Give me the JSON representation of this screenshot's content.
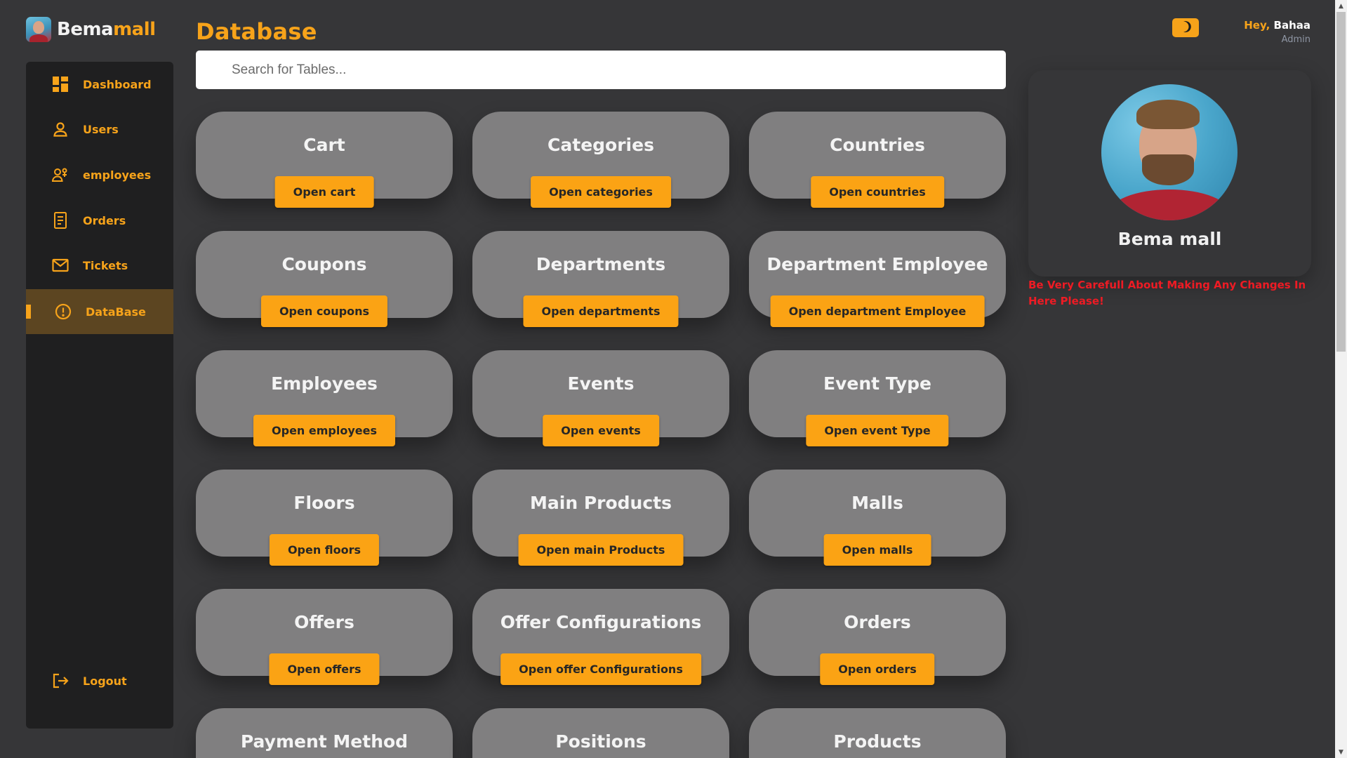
{
  "brand": {
    "part1": "Bema",
    "part2": "mall"
  },
  "sidebar": {
    "items": [
      {
        "label": "Dashboard",
        "icon": "dashboard-icon"
      },
      {
        "label": "Users",
        "icon": "user-icon"
      },
      {
        "label": "employees",
        "icon": "employees-icon"
      },
      {
        "label": "Orders",
        "icon": "receipt-icon"
      },
      {
        "label": "Tickets",
        "icon": "mail-icon"
      },
      {
        "label": "DataBase",
        "icon": "alert-circle-icon",
        "active": true
      }
    ],
    "logout": {
      "label": "Logout",
      "icon": "logout-icon"
    }
  },
  "header": {
    "title": "Database",
    "search_placeholder": "Search for Tables..."
  },
  "user": {
    "greeting": "Hey, ",
    "name": "Bahaa",
    "role": "Admin"
  },
  "profile": {
    "name": "Bema mall",
    "warning": "Be Very Carefull About Making Any Changes In Here Please!"
  },
  "tables": [
    {
      "title": "Cart",
      "button": "Open cart"
    },
    {
      "title": "Categories",
      "button": "Open categories"
    },
    {
      "title": "Countries",
      "button": "Open countries"
    },
    {
      "title": "Coupons",
      "button": "Open coupons"
    },
    {
      "title": "Departments",
      "button": "Open departments"
    },
    {
      "title": "Department Employee",
      "button": "Open department Employee"
    },
    {
      "title": "Employees",
      "button": "Open employees"
    },
    {
      "title": "Events",
      "button": "Open events"
    },
    {
      "title": "Event Type",
      "button": "Open event Type"
    },
    {
      "title": "Floors",
      "button": "Open floors"
    },
    {
      "title": "Main Products",
      "button": "Open main Products"
    },
    {
      "title": "Malls",
      "button": "Open malls"
    },
    {
      "title": "Offers",
      "button": "Open offers"
    },
    {
      "title": "Offer Configurations",
      "button": "Open offer Configurations"
    },
    {
      "title": "Orders",
      "button": "Open orders"
    },
    {
      "title": "Payment Method",
      "button": ""
    },
    {
      "title": "Positions",
      "button": ""
    },
    {
      "title": "Products",
      "button": ""
    }
  ],
  "colors": {
    "accent": "#f7a31a",
    "background": "#363638",
    "sidebar": "#1f1f20",
    "card": "#807f80",
    "warning": "#ee1b24"
  }
}
